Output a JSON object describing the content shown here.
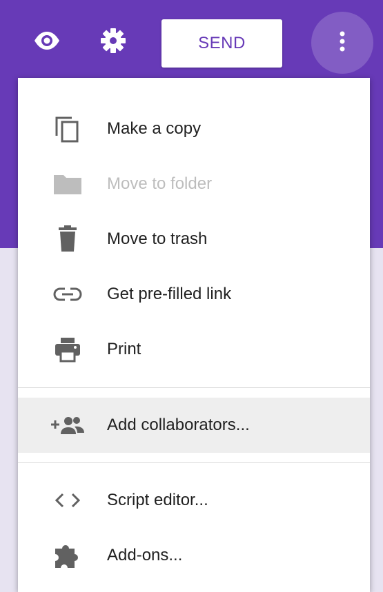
{
  "toolbar": {
    "preview_icon": "eye-icon",
    "settings_icon": "gear-icon",
    "send_label": "SEND",
    "more_icon": "more-vert-icon",
    "accent_color": "#673ab7"
  },
  "menu": {
    "items": [
      {
        "label": "Make a copy",
        "icon": "copy-icon",
        "disabled": false
      },
      {
        "label": "Move to folder",
        "icon": "folder-icon",
        "disabled": true
      },
      {
        "label": "Move to trash",
        "icon": "trash-icon",
        "disabled": false
      },
      {
        "label": "Get pre-filled link",
        "icon": "link-icon",
        "disabled": false
      },
      {
        "label": "Print",
        "icon": "print-icon",
        "disabled": false
      },
      {
        "label": "Add collaborators...",
        "icon": "add-people-icon",
        "disabled": false,
        "highlighted": true
      },
      {
        "label": "Script editor...",
        "icon": "code-icon",
        "disabled": false
      },
      {
        "label": "Add-ons...",
        "icon": "puzzle-icon",
        "disabled": false
      }
    ]
  }
}
